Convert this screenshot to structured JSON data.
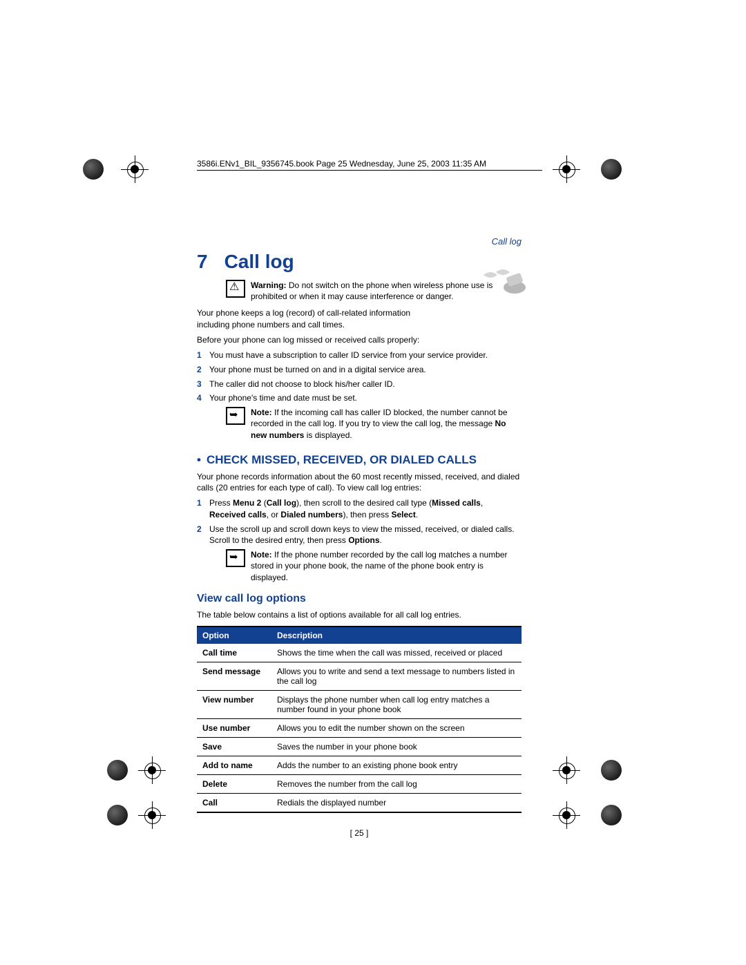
{
  "header": "3586i.ENv1_BIL_9356745.book  Page 25  Wednesday, June 25, 2003  11:35 AM",
  "running_head": "Call log",
  "chapter": {
    "num": "7",
    "title": "Call log"
  },
  "warning": {
    "label": "Warning:",
    "text": "Do not switch on the phone when wireless phone use is prohibited or when it may cause interference or danger."
  },
  "intro1": "Your phone keeps a log (record) of call-related information including phone numbers and call times.",
  "intro2": "Before your phone can log missed or received calls properly:",
  "prereqs": [
    "You must have a subscription to caller ID service from your service provider.",
    "Your phone must be turned on and in a digital service area.",
    "The caller did not choose to block his/her caller ID.",
    "Your phone's time and date must be set."
  ],
  "note1": {
    "label": "Note:",
    "text_a": "If the incoming call has caller ID blocked, the number cannot be recorded in the call log. If you try to view the call log, the message ",
    "bold": "No new numbers",
    "text_b": " is displayed."
  },
  "section1": {
    "title": "CHECK MISSED, RECEIVED, OR DIALED CALLS",
    "para": "Your phone records information about the 60 most recently missed, received, and dialed calls (20 entries for each type of call). To view call log entries:",
    "steps": [
      {
        "pre": "Press ",
        "b1": "Menu 2",
        "mid1": " (",
        "b2": "Call log",
        "mid2": "), then scroll to the desired call type (",
        "b3": "Missed calls",
        "mid3": ", ",
        "b4": "Received calls",
        "mid4": ", or ",
        "b5": "Dialed numbers",
        "mid5": "), then press ",
        "b6": "Select",
        "post": "."
      },
      {
        "pre": "Use the scroll up and scroll down keys to view the missed, received, or dialed calls. Scroll to the desired entry, then press ",
        "b1": "Options",
        "post": "."
      }
    ],
    "note": {
      "label": "Note:",
      "text": "If the phone number recorded by the call log matches a number stored in your phone book, the name of the phone book entry is displayed."
    }
  },
  "section2": {
    "title": "View call log options",
    "para": "The table below contains a list of options available for all call log entries.",
    "table": {
      "head": {
        "c1": "Option",
        "c2": "Description"
      },
      "rows": [
        {
          "c1": "Call time",
          "c2": "Shows the time when the call was missed, received or placed"
        },
        {
          "c1": "Send message",
          "c2": "Allows you to write and send a text message to numbers listed in the call log"
        },
        {
          "c1": "View number",
          "c2": "Displays the phone number when call log entry matches a number found in your phone book"
        },
        {
          "c1": "Use number",
          "c2": "Allows you to edit the number shown on the screen"
        },
        {
          "c1": "Save",
          "c2": "Saves the number in your phone book"
        },
        {
          "c1": "Add to name",
          "c2": "Adds the number to an existing phone book entry"
        },
        {
          "c1": "Delete",
          "c2": "Removes the number from the call log"
        },
        {
          "c1": "Call",
          "c2": "Redials the displayed number"
        }
      ]
    }
  },
  "page_num": "[ 25 ]"
}
